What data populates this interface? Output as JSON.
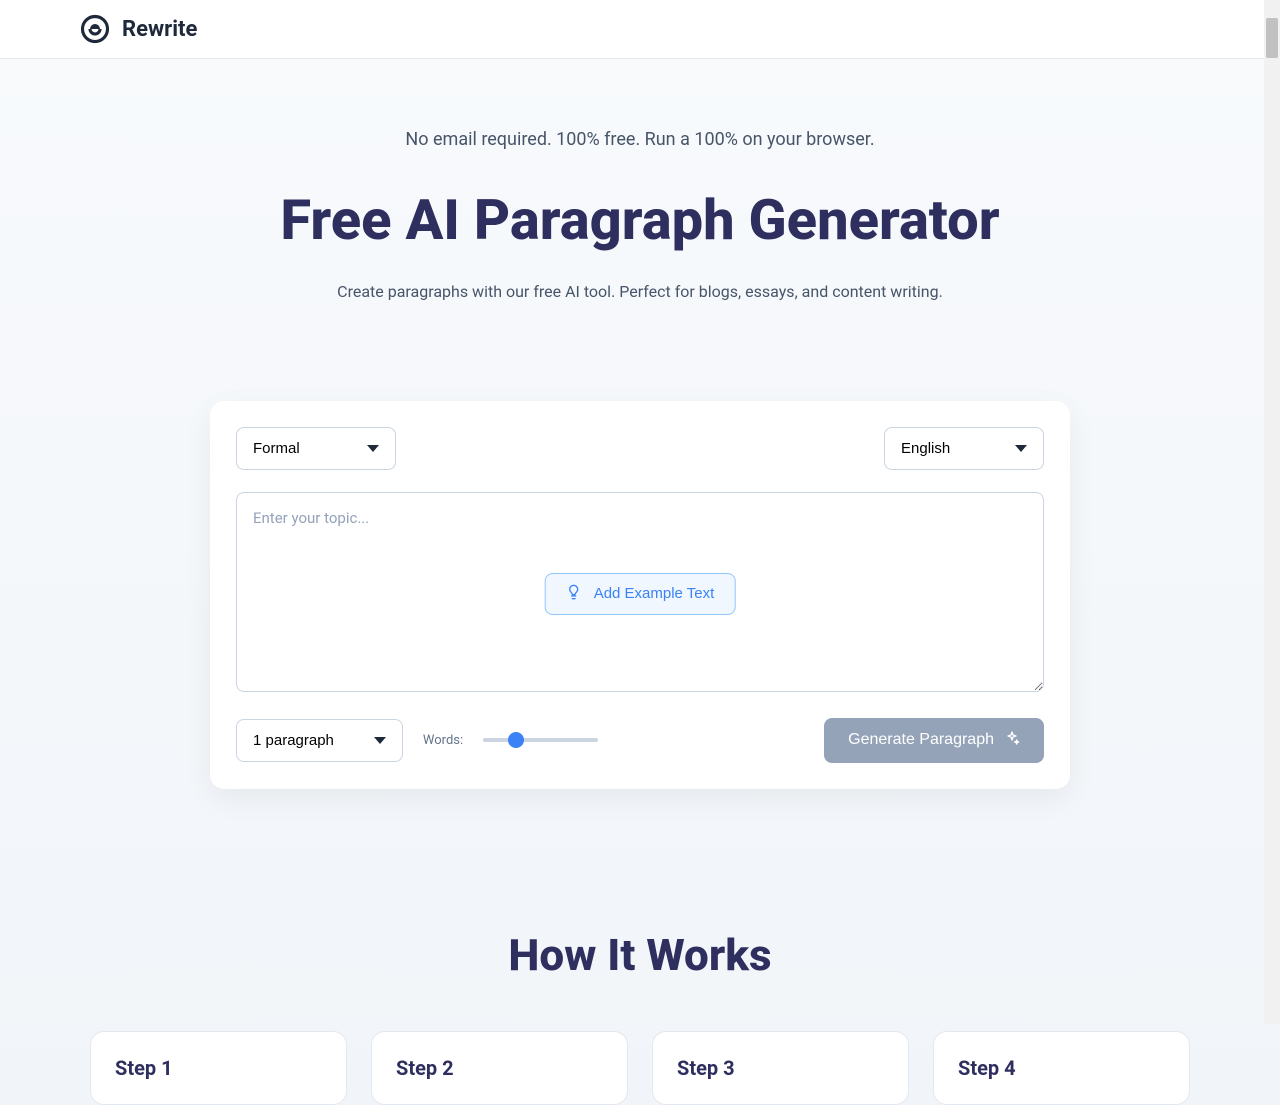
{
  "header": {
    "brand": "Rewrite"
  },
  "hero": {
    "pretitle": "No email required. 100% free. Run a 100% on your browser.",
    "title": "Free AI Paragraph Generator",
    "subtitle": "Create paragraphs with our free AI tool. Perfect for blogs, essays, and content writing."
  },
  "form": {
    "tone_selected": "Formal",
    "language_selected": "English",
    "textarea_placeholder": "Enter your topic...",
    "example_button": "Add Example Text",
    "paragraphs_selected": "1 paragraph",
    "words_label": "Words:",
    "words_value": 25,
    "words_min": 0,
    "words_max": 100,
    "generate_button": "Generate Paragraph"
  },
  "how_it_works": {
    "title": "How It Works",
    "steps": [
      {
        "title": "Step 1"
      },
      {
        "title": "Step 2"
      },
      {
        "title": "Step 3"
      },
      {
        "title": "Step 4"
      }
    ]
  }
}
